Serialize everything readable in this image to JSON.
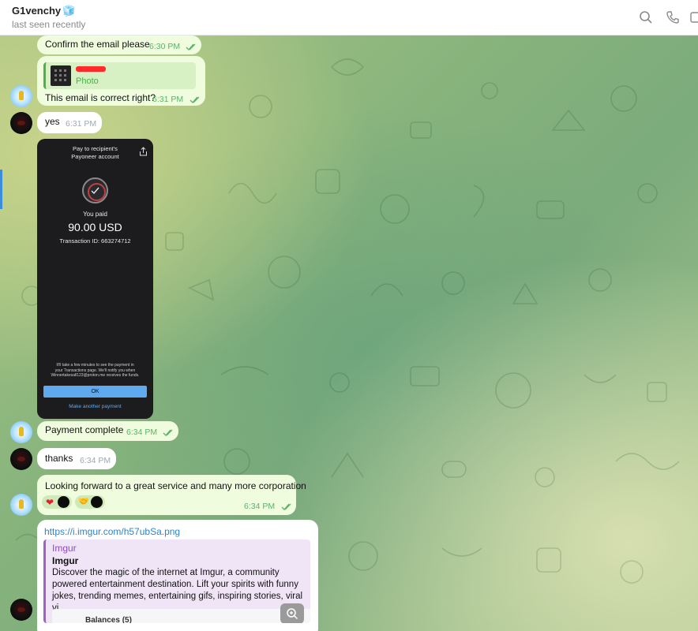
{
  "header": {
    "title": "G1venchy",
    "title_emoji": "🧊",
    "status": "last seen recently",
    "icons": [
      "search-icon",
      "phone-icon",
      "sidebar-toggle-icon"
    ]
  },
  "messages": [
    {
      "text": "Confirm the email please",
      "time": "6:30 PM",
      "read": true
    },
    {
      "reply_label": "Photo",
      "text": "This email is correct right?",
      "time": "6:31 PM",
      "read": true
    },
    {
      "text": "yes",
      "time": "6:31 PM"
    },
    {
      "text": "Payment complete",
      "time": "6:34 PM",
      "read": true
    },
    {
      "text": "thanks",
      "time": "6:34 PM"
    },
    {
      "text": "Looking forward to a great service and many more corporation",
      "time": "6:34 PM",
      "read": true,
      "reactions": [
        {
          "emoji": "❤"
        },
        {
          "emoji": "🤝"
        }
      ]
    },
    {
      "link": "https://i.imgur.com/h57ubSa.png"
    }
  ],
  "payment_screenshot": {
    "title": "Pay to recipient's\nPayoneer account",
    "you_paid": "You paid",
    "amount": "90.00 USD",
    "transaction": "Transaction ID: 663274712",
    "note": "It'll take a few minutes to see the payment in\nyour Transactions page. We'll notify you when\nWinnertakesall123@proton.me receives the funds.",
    "ok_label": "OK",
    "another_label": "Make another payment"
  },
  "link_preview": {
    "site": "Imgur",
    "title": "Imgur",
    "description": "Discover the magic of the internet at Imgur, a community\npowered entertainment destination. Lift your spirits with funny\njokes, trending memes, entertaining gifs, inspiring stories, viral vi...",
    "image_text": "Balances (5)"
  },
  "colors": {
    "outgoing_bubble": "#effdde",
    "incoming_bubble": "#ffffff",
    "time_green": "#5fb06a",
    "link": "#2f83c6",
    "preview_accent": "#9b63c4"
  }
}
